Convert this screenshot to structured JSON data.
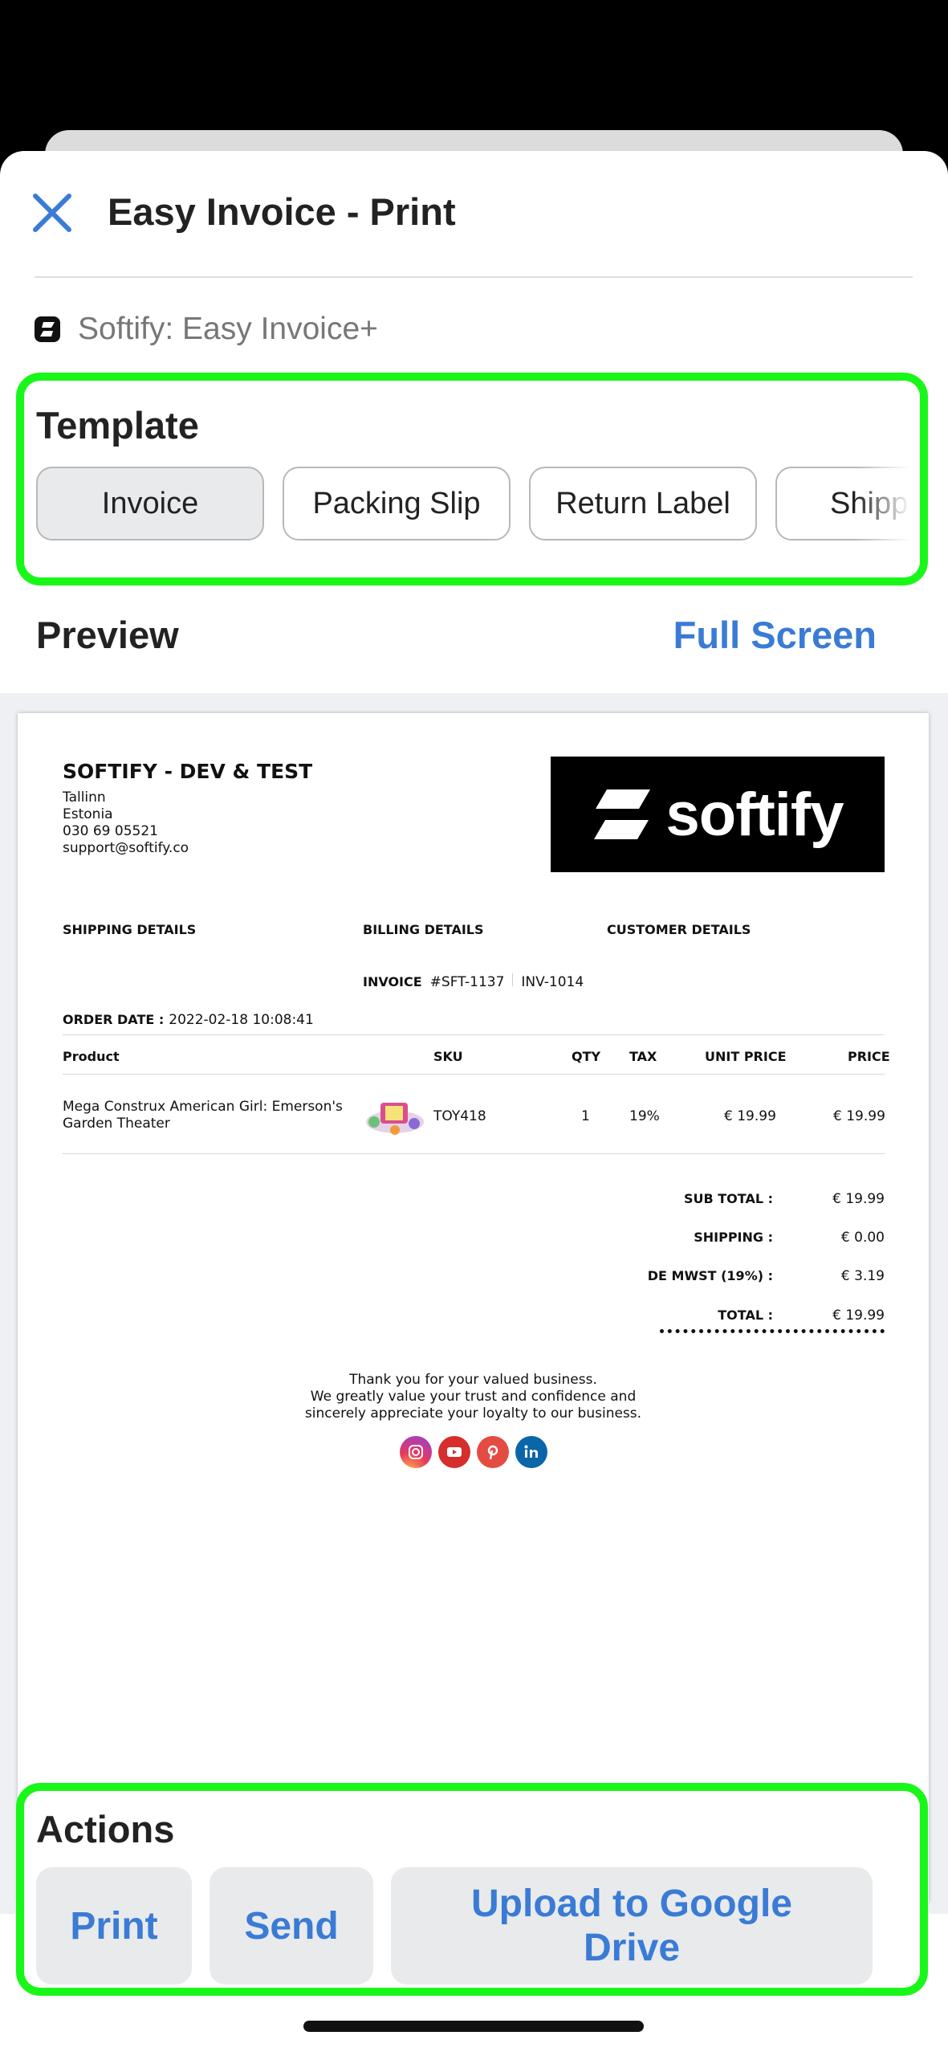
{
  "header": {
    "title": "Easy Invoice - Print"
  },
  "app": {
    "name": "Softify: Easy Invoice+"
  },
  "template": {
    "title": "Template",
    "options": [
      "Invoice",
      "Packing Slip",
      "Return Label",
      "Shipping"
    ],
    "selected": "Invoice"
  },
  "preview": {
    "title": "Preview",
    "full_screen": "Full Screen"
  },
  "invoice": {
    "company": {
      "name": "SOFTIFY - DEV & TEST",
      "lines": [
        "Tallinn",
        "Estonia",
        "030 69 05521",
        "support@softify.co"
      ]
    },
    "logo_text": "softify",
    "sections": {
      "shipping": "SHIPPING DETAILS",
      "billing": "BILLING DETAILS",
      "customer": "CUSTOMER DETAILS"
    },
    "invoice_label": "INVOICE",
    "invoice_number": "#SFT-1137",
    "invoice_ref": "INV-1014",
    "order_date_label": "ORDER DATE :",
    "order_date": "2022-02-18 10:08:41",
    "columns": {
      "product": "Product",
      "sku": "SKU",
      "qty": "QTY",
      "tax": "TAX",
      "unit_price": "UNIT PRICE",
      "price": "PRICE"
    },
    "items": [
      {
        "product": "Mega Construx American Girl: Emerson's Garden Theater",
        "sku": "TOY418",
        "qty": "1",
        "tax": "19%",
        "unit_price": "€ 19.99",
        "price": "€ 19.99"
      }
    ],
    "totals": [
      {
        "label": "SUB TOTAL :",
        "value": "€ 19.99"
      },
      {
        "label": "SHIPPING :",
        "value": "€ 0.00"
      },
      {
        "label": "DE MWST (19%) :",
        "value": "€ 3.19"
      },
      {
        "label": "TOTAL :",
        "value": "€ 19.99"
      }
    ],
    "thanks": [
      "Thank you for your valued business.",
      "We greatly value your trust and confidence and",
      "sincerely appreciate your loyalty to our business."
    ],
    "social_icons": [
      "instagram-icon",
      "youtube-icon",
      "pinterest-icon",
      "linkedin-icon"
    ]
  },
  "actions": {
    "title": "Actions",
    "buttons": [
      "Print",
      "Send",
      "Upload to Google Drive"
    ]
  },
  "colors": {
    "accent": "#3a7bd5",
    "highlight": "#19f719",
    "selected_bg": "#e8eaec"
  }
}
